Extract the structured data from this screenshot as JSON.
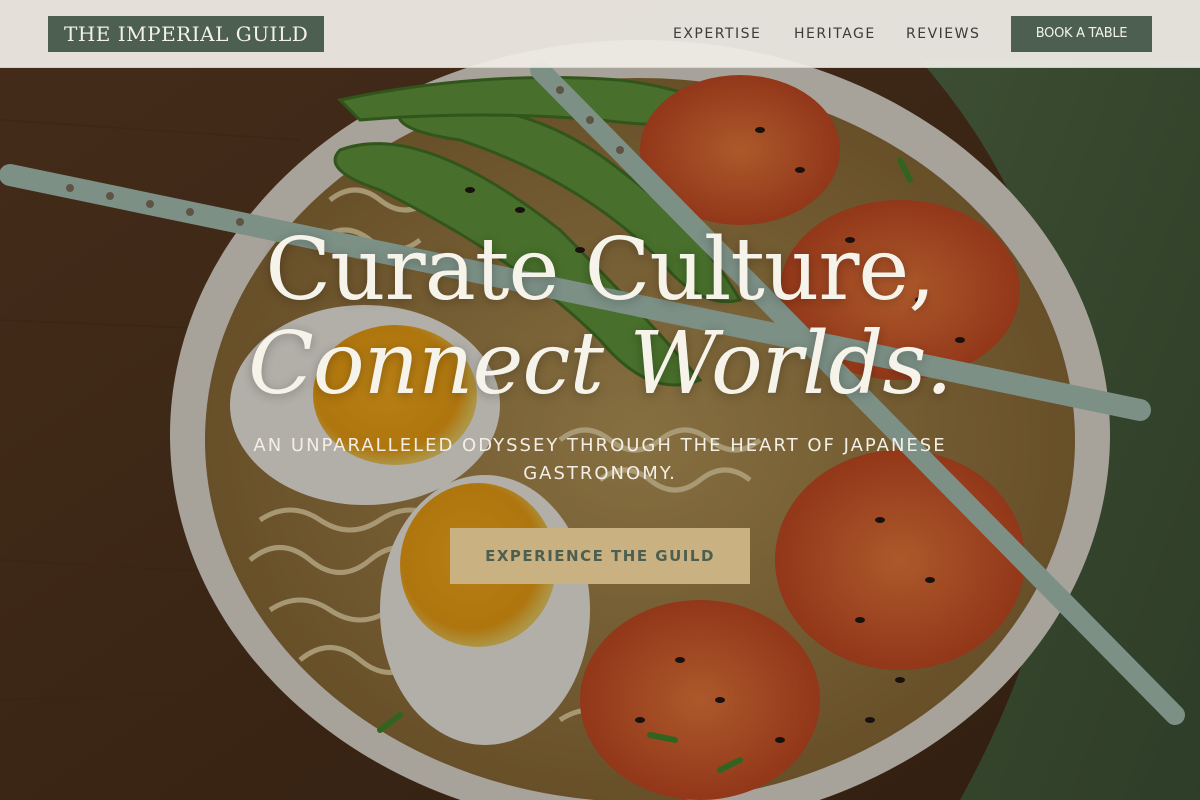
{
  "header": {
    "logo_text": "THE IMPERIAL GUILD",
    "nav": [
      {
        "label": "EXPERTISE"
      },
      {
        "label": "HERITAGE"
      },
      {
        "label": "REVIEWS"
      }
    ],
    "book_label": "BOOK A TABLE"
  },
  "hero": {
    "headline_line1": "Curate Culture,",
    "headline_line2": "Connect Worlds.",
    "subheading": "AN UNPARALLELED ODYSSEY THROUGH THE HEART OF JAPANESE GASTRONOMY.",
    "cta_label": "EXPERIENCE THE GUILD",
    "background_image": "ramen-bowl-photo"
  },
  "colors": {
    "brand_green": "#4c5f50",
    "gold": "#c9b182",
    "header_bg": "#eeece6",
    "text_light": "#f6f3ea"
  }
}
